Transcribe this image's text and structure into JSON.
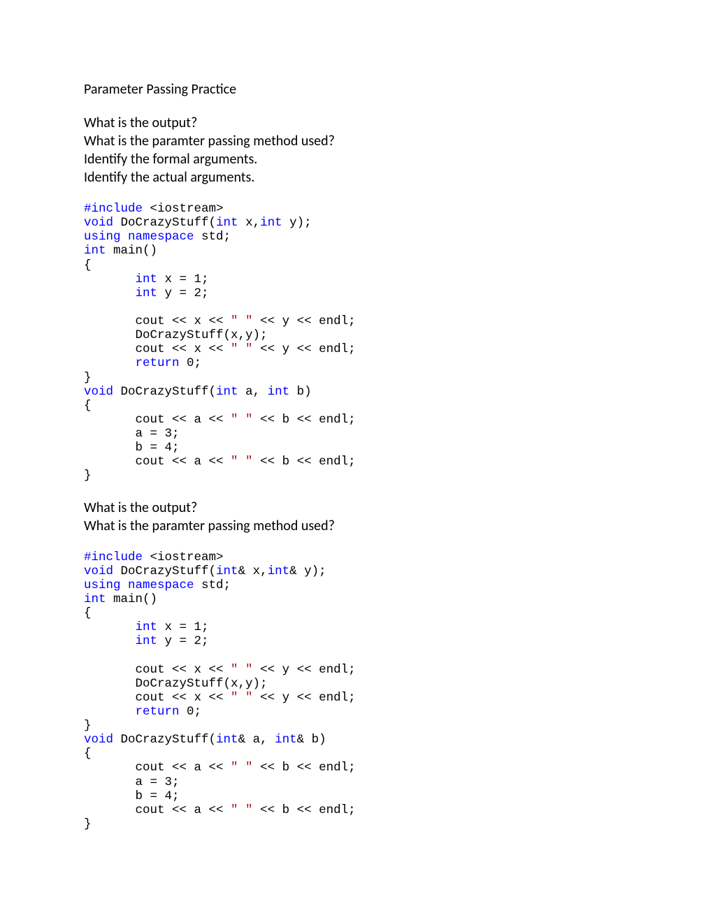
{
  "heading": "Parameter Passing Practice",
  "q1": {
    "l1": "What is the output?",
    "l2": "What is the paramter passing method used?",
    "l3": "Identify the formal arguments.",
    "l4": "Identify the actual arguments."
  },
  "code1": {
    "include_pre": "#include",
    "include_post": " <iostream>",
    "proto_void": "void",
    "proto_name": " DoCrazyStuff(",
    "proto_int1": "int",
    "proto_x": " x,",
    "proto_int2": "int",
    "proto_y": " y);",
    "using1": "using",
    "using_sp": " ",
    "using2": "namespace",
    "using_std": " std;",
    "main_int": "int",
    "main_rest": " main()",
    "brace_open": "{",
    "decl_x_pre": "       ",
    "decl_x_int": "int",
    "decl_x_rest": " x = 1;",
    "decl_y_pre": "       ",
    "decl_y_int": "int",
    "decl_y_rest": " y = 2;",
    "blank": "",
    "cout1_pre": "       cout << x << ",
    "cout1_str": "\" \"",
    "cout1_post": " << y << endl;",
    "call_pre": "       DoCrazyStuff(x,y);",
    "cout2_pre": "       cout << x << ",
    "cout2_str": "\" \"",
    "cout2_post": " << y << endl;",
    "ret_pre": "       ",
    "ret_kw": "return",
    "ret_post": " 0;",
    "brace_close": "}",
    "fn_void": "void",
    "fn_name": " DoCrazyStuff(",
    "fn_int1": "int",
    "fn_a": " a, ",
    "fn_int2": "int",
    "fn_b": " b)",
    "fn_open": "{",
    "fcout1_pre": "       cout << a << ",
    "fcout1_str": "\" \"",
    "fcout1_post": " << b << endl;",
    "fa": "       a = 3;",
    "fb": "       b = 4;",
    "fcout2_pre": "       cout << a << ",
    "fcout2_str": "\" \"",
    "fcout2_post": " << b << endl;",
    "fn_close": "}"
  },
  "q2": {
    "l1": "What is the output?",
    "l2": "What is the paramter passing method used?"
  },
  "code2": {
    "include_pre": "#include",
    "include_post": " <iostream>",
    "proto_void": "void",
    "proto_name": " DoCrazyStuff(",
    "proto_int1": "int",
    "proto_x": "& x,",
    "proto_int2": "int",
    "proto_y": "& y);",
    "using1": "using",
    "using_sp": " ",
    "using2": "namespace",
    "using_std": " std;",
    "main_int": "int",
    "main_rest": " main()",
    "brace_open": "{",
    "decl_x_pre": "       ",
    "decl_x_int": "int",
    "decl_x_rest": " x = 1;",
    "decl_y_pre": "       ",
    "decl_y_int": "int",
    "decl_y_rest": " y = 2;",
    "blank": "",
    "cout1_pre": "       cout << x << ",
    "cout1_str": "\" \"",
    "cout1_post": " << y << endl;",
    "call_pre": "       DoCrazyStuff(x,y);",
    "cout2_pre": "       cout << x << ",
    "cout2_str": "\" \"",
    "cout2_post": " << y << endl;",
    "ret_pre": "       ",
    "ret_kw": "return",
    "ret_post": " 0;",
    "brace_close": "}",
    "fn_void": "void",
    "fn_name": " DoCrazyStuff(",
    "fn_int1": "int",
    "fn_a": "& a, ",
    "fn_int2": "int",
    "fn_b": "& b)",
    "fn_open": "{",
    "fcout1_pre": "       cout << a << ",
    "fcout1_str": "\" \"",
    "fcout1_post": " << b << endl;",
    "fa": "       a = 3;",
    "fb": "       b = 4;",
    "fcout2_pre": "       cout << a << ",
    "fcout2_str": "\" \"",
    "fcout2_post": " << b << endl;",
    "fn_close": "}"
  }
}
